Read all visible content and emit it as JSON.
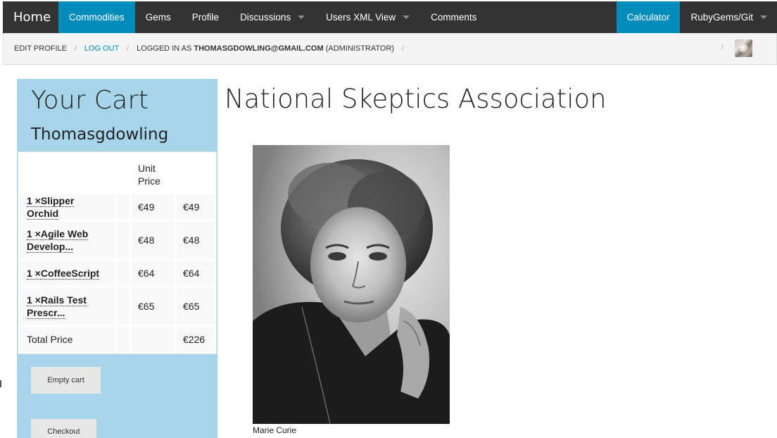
{
  "nav": {
    "home": "Home",
    "left_items": [
      {
        "label": "Commodities",
        "active": true,
        "dropdown": false
      },
      {
        "label": "Gems",
        "active": false,
        "dropdown": false
      },
      {
        "label": "Profile",
        "active": false,
        "dropdown": false
      },
      {
        "label": "Discussions",
        "active": false,
        "dropdown": true
      },
      {
        "label": "Users XML View",
        "active": false,
        "dropdown": true
      },
      {
        "label": "Comments",
        "active": false,
        "dropdown": false
      }
    ],
    "right_items": [
      {
        "label": "Calculator",
        "active": true,
        "dropdown": false
      },
      {
        "label": "RubyGems/Git",
        "active": false,
        "dropdown": true
      }
    ],
    "active_color": "#008cba",
    "bar_color": "#333333"
  },
  "breadcrumbs": {
    "edit_profile": "Edit Profile",
    "log_out": "Log Out",
    "logged_in_prefix": "Logged in as ",
    "email": "thomasgdowling@gmail.com",
    "role": " (Administrator)",
    "separator": "/"
  },
  "cart": {
    "title": "Your Cart",
    "user": "Thomasgdowling",
    "unit_price_header": "Unit Price",
    "items": [
      {
        "qty": "1 ×",
        "name": "Slipper Orchid",
        "unit": "€49",
        "total": "€49"
      },
      {
        "qty": "1 ×",
        "name": "Agile Web Develop...",
        "unit": "€48",
        "total": "€48"
      },
      {
        "qty": "1 ×",
        "name": "CoffeeScript",
        "unit": "€64",
        "total": "€64"
      },
      {
        "qty": "1 ×",
        "name": "Rails Test Prescr...",
        "unit": "€65",
        "total": "€65"
      }
    ],
    "total_label": "Total Price",
    "total_value": "€226",
    "empty_button": "Empty cart",
    "checkout_button": "Checkout",
    "panel_color": "#a6d4e8"
  },
  "main": {
    "title": "National Skeptics Association",
    "image_caption": "Marie Curie"
  }
}
